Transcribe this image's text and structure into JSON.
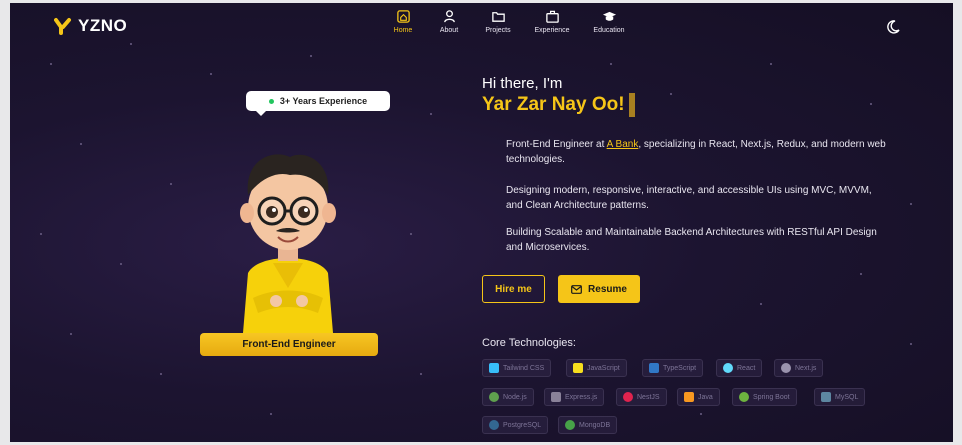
{
  "logo": {
    "text": "YZNO",
    "color": "#f5c518"
  },
  "nav": {
    "items": [
      {
        "label": "Home",
        "icon": "home-icon",
        "active": true
      },
      {
        "label": "About",
        "icon": "user-icon",
        "active": false
      },
      {
        "label": "Projects",
        "icon": "folder-icon",
        "active": false
      },
      {
        "label": "Experience",
        "icon": "briefcase-icon",
        "active": false
      },
      {
        "label": "Education",
        "icon": "graduation-cap-icon",
        "active": false
      }
    ],
    "theme_toggle_icon": "moon-icon"
  },
  "hero_left": {
    "badge": "3+ Years Experience",
    "role": "Front-End Engineer"
  },
  "hero_right": {
    "greeting": "Hi there, I'm",
    "name": "Yar Zar Nay Oo!",
    "bio1_prefix": "Front-End Engineer at ",
    "bio1_link": "A Bank",
    "bio1_suffix": ", specializing in React, Next.js, Redux, and modern web technologies.",
    "bio2": "Designing modern, responsive, interactive, and accessible UIs using MVC, MVVM, and Clean Architecture patterns.",
    "bio3": "Building Scalable and Maintainable Backend Architectures with RESTful API Design and Microservices.",
    "hire_label": "Hire me",
    "resume_label": "Resume"
  },
  "core": {
    "title": "Core Technologies:",
    "techs": [
      {
        "label": "Tailwind CSS",
        "icon": "tailwind-icon",
        "color": "#38bdf8"
      },
      {
        "label": "JavaScript",
        "icon": "javascript-icon",
        "color": "#f7df1e"
      },
      {
        "label": "TypeScript",
        "icon": "typescript-icon",
        "color": "#3178c6"
      },
      {
        "label": "React",
        "icon": "react-icon",
        "color": "#61dafb"
      },
      {
        "label": "Next.js",
        "icon": "nextjs-icon",
        "color": "#9a93ad"
      },
      {
        "label": "Node.js",
        "icon": "nodejs-icon",
        "color": "#5fa04e"
      },
      {
        "label": "Express.js",
        "icon": "express-icon",
        "color": "#8a8299"
      },
      {
        "label": "NestJS",
        "icon": "nestjs-icon",
        "color": "#e0234e"
      },
      {
        "label": "Java",
        "icon": "java-icon",
        "color": "#f89820"
      },
      {
        "label": "Spring Boot",
        "icon": "spring-boot-icon",
        "color": "#6db33f"
      },
      {
        "label": "MySQL",
        "icon": "mysql-icon",
        "color": "#5d87a1"
      },
      {
        "label": "PostgreSQL",
        "icon": "postgresql-icon",
        "color": "#336791"
      },
      {
        "label": "MongoDB",
        "icon": "mongodb-icon",
        "color": "#47a248"
      }
    ]
  },
  "colors": {
    "accent": "#f5c518",
    "background": "#1c1430"
  }
}
